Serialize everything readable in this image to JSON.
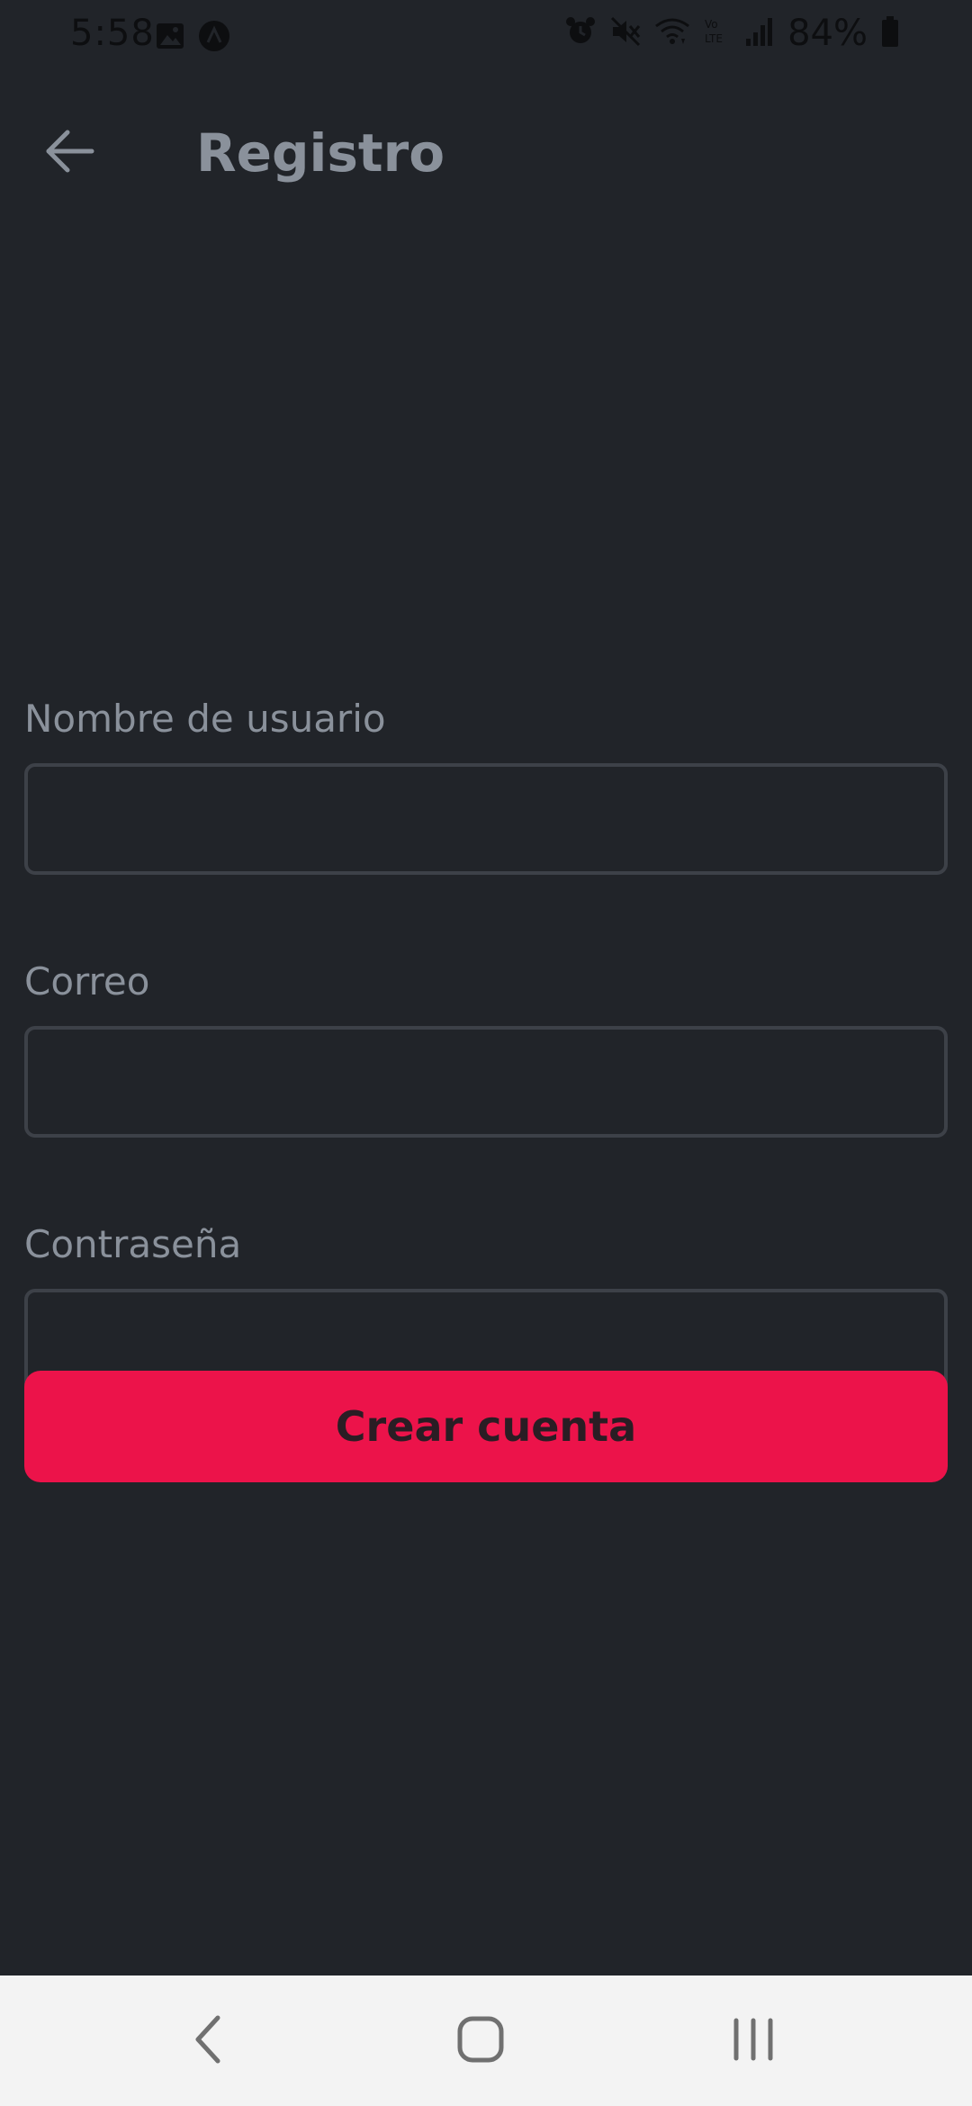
{
  "status_bar": {
    "time": "5:58",
    "battery": "84%",
    "left_icons": [
      "image-icon",
      "notification-a-icon"
    ],
    "right_icons": [
      "alarm-icon",
      "mute-icon",
      "wifi-icon",
      "volte-icon",
      "signal-icon",
      "battery-icon"
    ]
  },
  "app_bar": {
    "title": "Registro",
    "back_icon": "arrow-left-icon"
  },
  "form": {
    "username": {
      "label": "Nombre de usuario",
      "value": ""
    },
    "email": {
      "label": "Correo",
      "value": ""
    },
    "password": {
      "label": "Contraseña",
      "value": ""
    },
    "submit_label": "Crear cuenta"
  },
  "nav_bar": {
    "buttons": [
      "back-nav-icon",
      "home-nav-icon",
      "recents-nav-icon"
    ]
  },
  "colors": {
    "background": "#212429",
    "accent": "#ec134a",
    "label": "#8a919b",
    "input_border": "#3d4148",
    "nav_background": "#f3f3f3"
  }
}
